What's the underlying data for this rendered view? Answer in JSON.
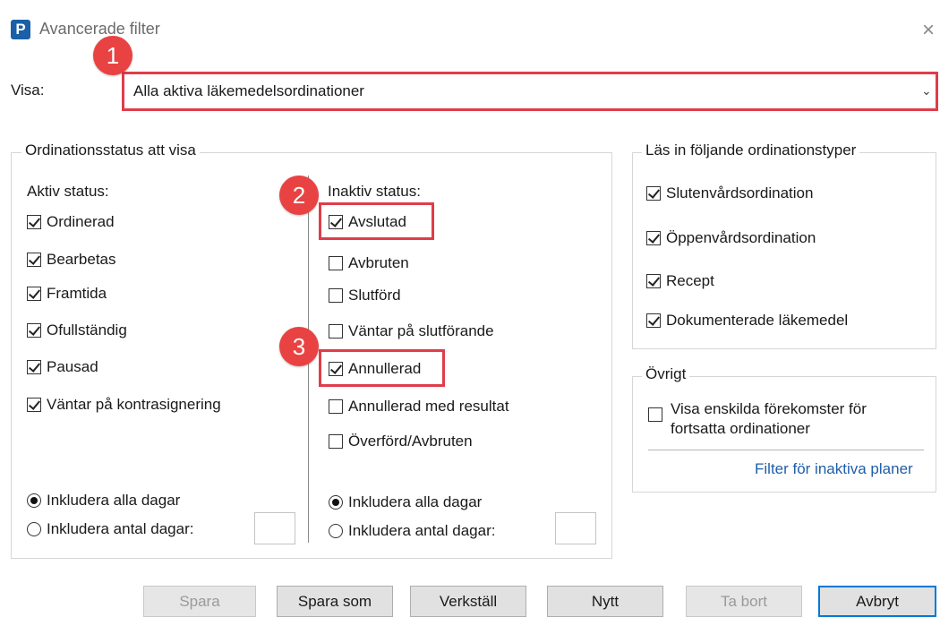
{
  "window": {
    "title": "Avancerade filter",
    "app_icon_letter": "P",
    "close_glyph": "×"
  },
  "show": {
    "label": "Visa:",
    "selected": "Alla aktiva läkemedelsordinationer"
  },
  "status_group": {
    "legend": "Ordinationsstatus att visa",
    "active": {
      "heading": "Aktiv status:",
      "items": [
        {
          "label": "Ordinerad",
          "checked": true
        },
        {
          "label": "Bearbetas",
          "checked": true
        },
        {
          "label": "Framtida",
          "checked": true
        },
        {
          "label": "Ofullständig",
          "checked": true
        },
        {
          "label": "Pausad",
          "checked": true
        },
        {
          "label": "Väntar på kontrasignering",
          "checked": true
        }
      ],
      "radio_all": "Inkludera alla dagar",
      "radio_count": "Inkludera antal dagar:"
    },
    "inactive": {
      "heading": "Inaktiv status:",
      "items": [
        {
          "label": "Avslutad",
          "checked": true
        },
        {
          "label": "Avbruten",
          "checked": false
        },
        {
          "label": "Slutförd",
          "checked": false
        },
        {
          "label": "Väntar på slutförande",
          "checked": false
        },
        {
          "label": "Annullerad",
          "checked": true
        },
        {
          "label": "Annullerad med resultat",
          "checked": false
        },
        {
          "label": "Överförd/Avbruten",
          "checked": false
        }
      ],
      "radio_all": "Inkludera alla dagar",
      "radio_count": "Inkludera antal dagar:"
    }
  },
  "types_group": {
    "legend": "Läs in följande ordinationstyper",
    "items": [
      {
        "label": "Slutenvårdsordination",
        "checked": true
      },
      {
        "label": "Öppenvårdsordination",
        "checked": true
      },
      {
        "label": "Recept",
        "checked": true
      },
      {
        "label": "Dokumenterade läkemedel",
        "checked": true
      }
    ]
  },
  "other_group": {
    "legend": "Övrigt",
    "checkbox_line1": "Visa enskilda förekomster för",
    "checkbox_line2": "fortsatta ordinationer",
    "link": "Filter för inaktiva planer"
  },
  "buttons": {
    "save": "Spara",
    "save_as": "Spara som",
    "apply": "Verkställ",
    "new": "Nytt",
    "delete": "Ta bort",
    "cancel": "Avbryt"
  },
  "markers": {
    "m1": "1",
    "m2": "2",
    "m3": "3"
  },
  "colors": {
    "highlight": "#e03c4a",
    "marker": "#e94242",
    "link": "#1f5fa8",
    "app_icon": "#1b5fa8"
  }
}
